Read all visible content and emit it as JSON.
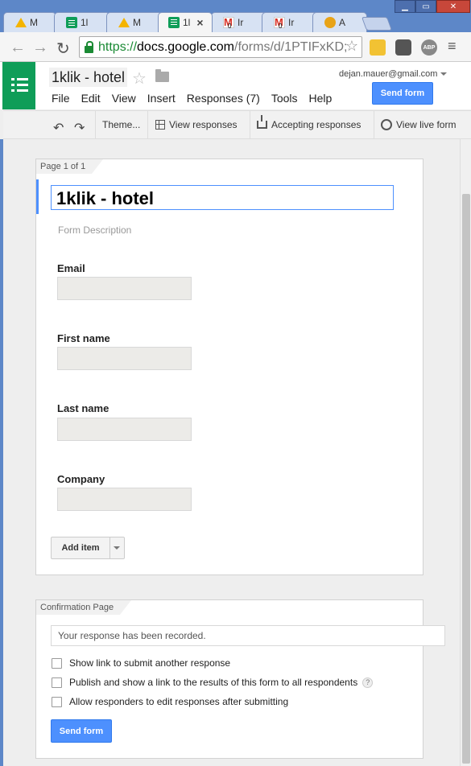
{
  "browser": {
    "tabs": [
      {
        "label": "M",
        "icon": "google-drive-icon"
      },
      {
        "label": "1l",
        "icon": "google-sheets-icon"
      },
      {
        "label": "M",
        "icon": "google-drive-icon"
      },
      {
        "label": "1l",
        "icon": "google-forms-icon",
        "active": true
      },
      {
        "label": "Ir",
        "icon": "gmail-icon"
      },
      {
        "label": "Ir",
        "icon": "gmail-icon"
      },
      {
        "label": "A",
        "icon": "person-icon"
      }
    ],
    "url_scheme": "https://",
    "url_host": "docs.google.com",
    "url_path": "/forms/d/1PTIFxKD;"
  },
  "header": {
    "doc_title": "1klik - hotel",
    "account": "dejan.mauer@gmail.com",
    "send_label": "Send form",
    "menu": [
      "File",
      "Edit",
      "View",
      "Insert",
      "Responses (7)",
      "Tools",
      "Help"
    ]
  },
  "toolbar": {
    "theme": "Theme...",
    "view_responses": "View responses",
    "accepting": "Accepting responses",
    "view_live": "View live form"
  },
  "form": {
    "page_label": "Page 1 of 1",
    "title": "1klik - hotel",
    "description_placeholder": "Form Description",
    "questions": [
      "Email",
      "First name",
      "Last name",
      "Company"
    ],
    "add_item": "Add item"
  },
  "confirmation": {
    "label": "Confirmation Page",
    "message": "Your response has been recorded.",
    "options": [
      "Show link to submit another response",
      "Publish and show a link to the results of this form to all respondents",
      "Allow responders to edit responses after submitting"
    ],
    "help_glyph": "?",
    "send_label": "Send form"
  },
  "colors": {
    "accent": "#4d90fe",
    "forms_green": "#0f9d58",
    "chrome_frame": "#5d87c8"
  }
}
